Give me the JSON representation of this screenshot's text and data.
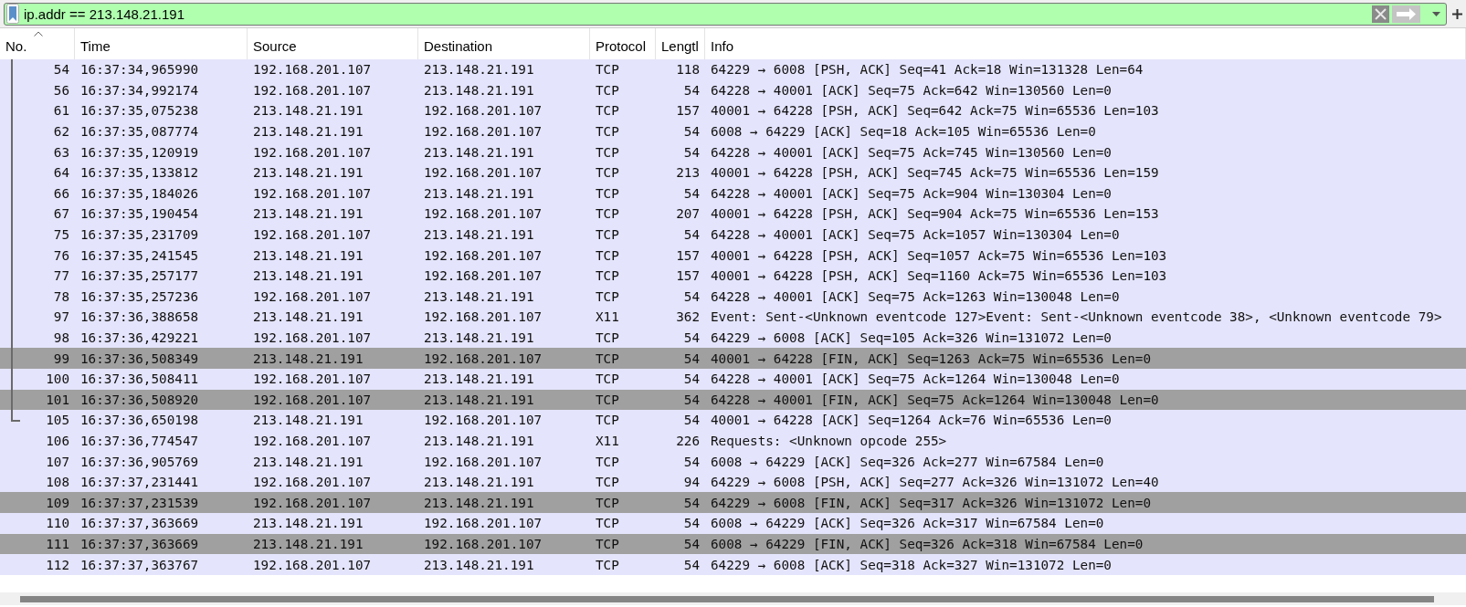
{
  "filter": {
    "value": "ip.addr == 213.148.21.191"
  },
  "columns": [
    {
      "label": "No.",
      "sorted": true
    },
    {
      "label": "Time",
      "sorted": false
    },
    {
      "label": "Source",
      "sorted": false
    },
    {
      "label": "Destination",
      "sorted": false
    },
    {
      "label": "Protocol",
      "sorted": false
    },
    {
      "label": "Lengtl",
      "sorted": false
    },
    {
      "label": "Info",
      "sorted": false
    }
  ],
  "rows": [
    {
      "no": "54",
      "time": "16:37:34,965990",
      "source": "192.168.201.107",
      "destination": "213.148.21.191",
      "protocol": "TCP",
      "length": "118",
      "info": "64229 → 6008 [PSH, ACK] Seq=41 Ack=18 Win=131328 Len=64",
      "color": "#e4e4fc",
      "kind": "related"
    },
    {
      "no": "56",
      "time": "16:37:34,992174",
      "source": "192.168.201.107",
      "destination": "213.148.21.191",
      "protocol": "TCP",
      "length": "54",
      "info": "64228 → 40001 [ACK] Seq=75 Ack=642 Win=130560 Len=0",
      "color": "#e4e4fc",
      "kind": "related"
    },
    {
      "no": "61",
      "time": "16:37:35,075238",
      "source": "213.148.21.191",
      "destination": "192.168.201.107",
      "protocol": "TCP",
      "length": "157",
      "info": "40001 → 64228 [PSH, ACK] Seq=642 Ack=75 Win=65536 Len=103",
      "color": "#e4e4fc",
      "kind": "related"
    },
    {
      "no": "62",
      "time": "16:37:35,087774",
      "source": "213.148.21.191",
      "destination": "192.168.201.107",
      "protocol": "TCP",
      "length": "54",
      "info": "6008 → 64229 [ACK] Seq=18 Ack=105 Win=65536 Len=0",
      "color": "#e4e4fc",
      "kind": "related"
    },
    {
      "no": "63",
      "time": "16:37:35,120919",
      "source": "192.168.201.107",
      "destination": "213.148.21.191",
      "protocol": "TCP",
      "length": "54",
      "info": "64228 → 40001 [ACK] Seq=75 Ack=745 Win=130560 Len=0",
      "color": "#e4e4fc",
      "kind": "related"
    },
    {
      "no": "64",
      "time": "16:37:35,133812",
      "source": "213.148.21.191",
      "destination": "192.168.201.107",
      "protocol": "TCP",
      "length": "213",
      "info": "40001 → 64228 [PSH, ACK] Seq=745 Ack=75 Win=65536 Len=159",
      "color": "#e4e4fc",
      "kind": "related"
    },
    {
      "no": "66",
      "time": "16:37:35,184026",
      "source": "192.168.201.107",
      "destination": "213.148.21.191",
      "protocol": "TCP",
      "length": "54",
      "info": "64228 → 40001 [ACK] Seq=75 Ack=904 Win=130304 Len=0",
      "color": "#e4e4fc",
      "kind": "related"
    },
    {
      "no": "67",
      "time": "16:37:35,190454",
      "source": "213.148.21.191",
      "destination": "192.168.201.107",
      "protocol": "TCP",
      "length": "207",
      "info": "40001 → 64228 [PSH, ACK] Seq=904 Ack=75 Win=65536 Len=153",
      "color": "#e4e4fc",
      "kind": "related"
    },
    {
      "no": "75",
      "time": "16:37:35,231709",
      "source": "192.168.201.107",
      "destination": "213.148.21.191",
      "protocol": "TCP",
      "length": "54",
      "info": "64228 → 40001 [ACK] Seq=75 Ack=1057 Win=130304 Len=0",
      "color": "#e4e4fc",
      "kind": "related"
    },
    {
      "no": "76",
      "time": "16:37:35,241545",
      "source": "213.148.21.191",
      "destination": "192.168.201.107",
      "protocol": "TCP",
      "length": "157",
      "info": "40001 → 64228 [PSH, ACK] Seq=1057 Ack=75 Win=65536 Len=103",
      "color": "#e4e4fc",
      "kind": "related"
    },
    {
      "no": "77",
      "time": "16:37:35,257177",
      "source": "213.148.21.191",
      "destination": "192.168.201.107",
      "protocol": "TCP",
      "length": "157",
      "info": "40001 → 64228 [PSH, ACK] Seq=1160 Ack=75 Win=65536 Len=103",
      "color": "#e4e4fc",
      "kind": "related"
    },
    {
      "no": "78",
      "time": "16:37:35,257236",
      "source": "192.168.201.107",
      "destination": "213.148.21.191",
      "protocol": "TCP",
      "length": "54",
      "info": "64228 → 40001 [ACK] Seq=75 Ack=1263 Win=130048 Len=0",
      "color": "#e4e4fc",
      "kind": "related"
    },
    {
      "no": "97",
      "time": "16:37:36,388658",
      "source": "213.148.21.191",
      "destination": "192.168.201.107",
      "protocol": "X11",
      "length": "362",
      "info": "Event: Sent-<Unknown eventcode 127>Event: Sent-<Unknown eventcode 38>, <Unknown eventcode 79>",
      "color": "#e4e4fc",
      "kind": "related"
    },
    {
      "no": "98",
      "time": "16:37:36,429221",
      "source": "192.168.201.107",
      "destination": "213.148.21.191",
      "protocol": "TCP",
      "length": "54",
      "info": "64229 → 6008 [ACK] Seq=105 Ack=326 Win=131072 Len=0",
      "color": "#e4e4fc",
      "kind": "related"
    },
    {
      "no": "99",
      "time": "16:37:36,508349",
      "source": "213.148.21.191",
      "destination": "192.168.201.107",
      "protocol": "TCP",
      "length": "54",
      "info": "40001 → 64228 [FIN, ACK] Seq=1263 Ack=75 Win=65536 Len=0",
      "color": "#a0a0a0",
      "kind": "related"
    },
    {
      "no": "100",
      "time": "16:37:36,508411",
      "source": "192.168.201.107",
      "destination": "213.148.21.191",
      "protocol": "TCP",
      "length": "54",
      "info": "64228 → 40001 [ACK] Seq=75 Ack=1264 Win=130048 Len=0",
      "color": "#e4e4fc",
      "kind": "related"
    },
    {
      "no": "101",
      "time": "16:37:36,508920",
      "source": "192.168.201.107",
      "destination": "213.148.21.191",
      "protocol": "TCP",
      "length": "54",
      "info": "64228 → 40001 [FIN, ACK] Seq=75 Ack=1264 Win=130048 Len=0",
      "color": "#a0a0a0",
      "kind": "related"
    },
    {
      "no": "105",
      "time": "16:37:36,650198",
      "source": "213.148.21.191",
      "destination": "192.168.201.107",
      "protocol": "TCP",
      "length": "54",
      "info": "40001 → 64228 [ACK] Seq=1264 Ack=76 Win=65536 Len=0",
      "color": "#e4e4fc",
      "kind": "related-last"
    },
    {
      "no": "106",
      "time": "16:37:36,774547",
      "source": "192.168.201.107",
      "destination": "213.148.21.191",
      "protocol": "X11",
      "length": "226",
      "info": "Requests: <Unknown opcode 255>",
      "color": "#e4e4fc",
      "kind": "plain"
    },
    {
      "no": "107",
      "time": "16:37:36,905769",
      "source": "213.148.21.191",
      "destination": "192.168.201.107",
      "protocol": "TCP",
      "length": "54",
      "info": "6008 → 64229 [ACK] Seq=326 Ack=277 Win=67584 Len=0",
      "color": "#e4e4fc",
      "kind": "plain"
    },
    {
      "no": "108",
      "time": "16:37:37,231441",
      "source": "192.168.201.107",
      "destination": "213.148.21.191",
      "protocol": "TCP",
      "length": "94",
      "info": "64229 → 6008 [PSH, ACK] Seq=277 Ack=326 Win=131072 Len=40",
      "color": "#e4e4fc",
      "kind": "plain"
    },
    {
      "no": "109",
      "time": "16:37:37,231539",
      "source": "192.168.201.107",
      "destination": "213.148.21.191",
      "protocol": "TCP",
      "length": "54",
      "info": "64229 → 6008 [FIN, ACK] Seq=317 Ack=326 Win=131072 Len=0",
      "color": "#a0a0a0",
      "kind": "plain"
    },
    {
      "no": "110",
      "time": "16:37:37,363669",
      "source": "213.148.21.191",
      "destination": "192.168.201.107",
      "protocol": "TCP",
      "length": "54",
      "info": "6008 → 64229 [ACK] Seq=326 Ack=317 Win=67584 Len=0",
      "color": "#e4e4fc",
      "kind": "plain"
    },
    {
      "no": "111",
      "time": "16:37:37,363669",
      "source": "213.148.21.191",
      "destination": "192.168.201.107",
      "protocol": "TCP",
      "length": "54",
      "info": "6008 → 64229 [FIN, ACK] Seq=326 Ack=318 Win=67584 Len=0",
      "color": "#a0a0a0",
      "kind": "plain"
    },
    {
      "no": "112",
      "time": "16:37:37,363767",
      "source": "192.168.201.107",
      "destination": "213.148.21.191",
      "protocol": "TCP",
      "length": "54",
      "info": "64229 → 6008 [ACK] Seq=318 Ack=327 Win=131072 Len=0",
      "color": "#e4e4fc",
      "kind": "plain"
    }
  ]
}
